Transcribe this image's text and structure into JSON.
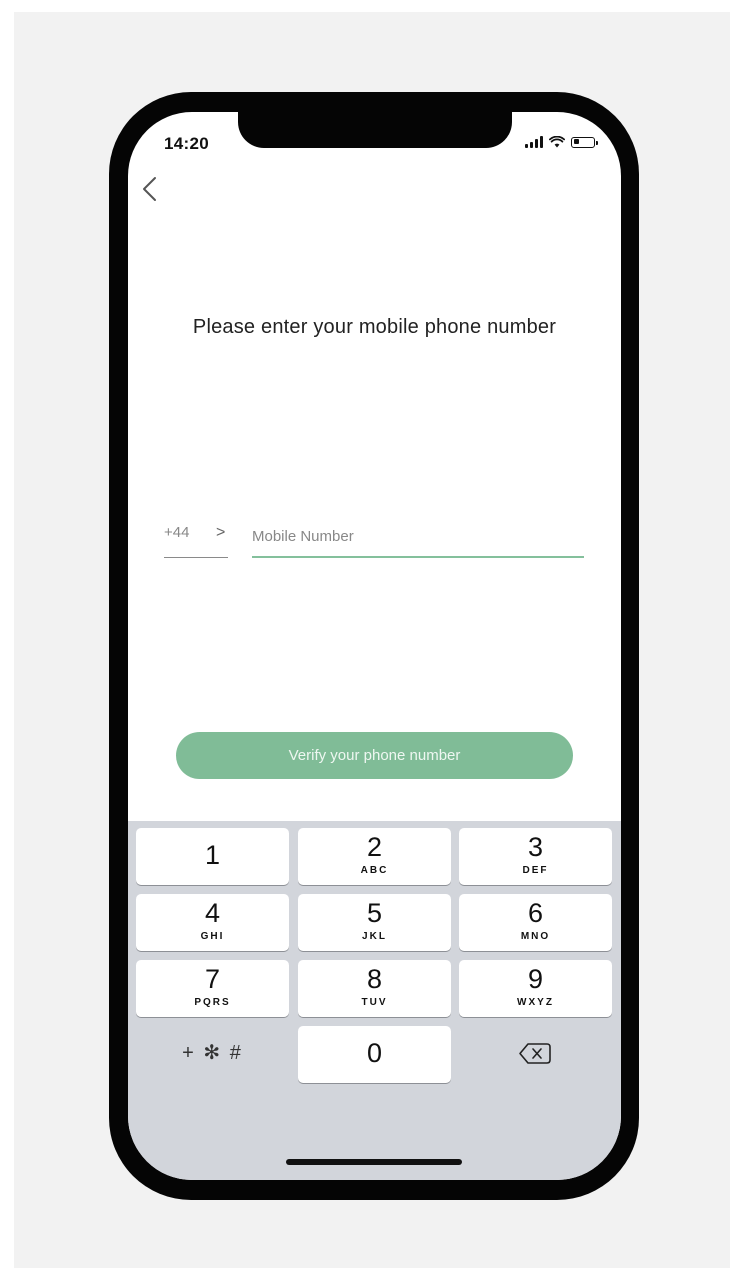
{
  "status_bar": {
    "time": "14:20",
    "battery_level": 0.3
  },
  "header": {
    "back_icon": "chevron-left-icon"
  },
  "prompt": {
    "text": "Please enter your mobile phone number"
  },
  "phone_form": {
    "country_code": "+44",
    "country_chevron": ">",
    "mobile_placeholder": "Mobile Number",
    "mobile_value": ""
  },
  "verify_button": {
    "label": "Verify your phone number"
  },
  "keypad": {
    "keys": [
      {
        "digit": "1",
        "letters": ""
      },
      {
        "digit": "2",
        "letters": "ABC"
      },
      {
        "digit": "3",
        "letters": "DEF"
      },
      {
        "digit": "4",
        "letters": "GHI"
      },
      {
        "digit": "5",
        "letters": "JKL"
      },
      {
        "digit": "6",
        "letters": "MNO"
      },
      {
        "digit": "7",
        "letters": "PQRS"
      },
      {
        "digit": "8",
        "letters": "TUV"
      },
      {
        "digit": "9",
        "letters": "WXYZ"
      },
      {
        "digit": "0",
        "letters": ""
      }
    ],
    "symbols_label": "+ ✻ #",
    "delete_icon": "backspace-icon"
  },
  "colors": {
    "accent": "#80bc97",
    "keyboard_bg": "#d2d5db"
  }
}
